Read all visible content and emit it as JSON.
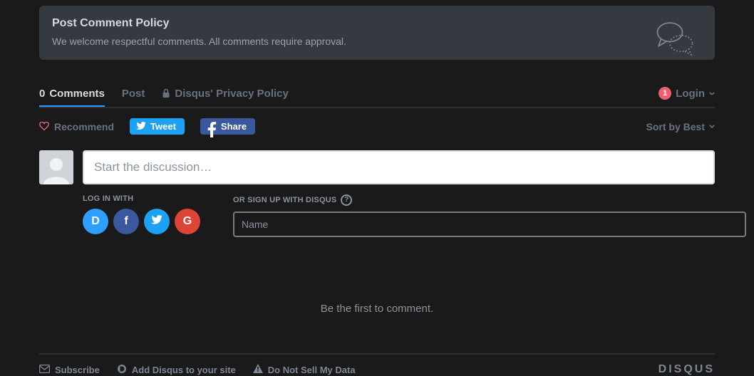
{
  "policy": {
    "title": "Post Comment Policy",
    "text": "We welcome respectful comments. All comments require approval."
  },
  "tabs": {
    "comments_count": "0",
    "comments_label": "Comments",
    "community_label": "Post",
    "privacy_label": "Disqus' Privacy Policy"
  },
  "login": {
    "badge": "1",
    "label": "Login"
  },
  "actions": {
    "recommend": "Recommend",
    "tweet": "Tweet",
    "share": "Share",
    "sort": "Sort by Best"
  },
  "compose": {
    "placeholder": "Start the discussion…"
  },
  "signup": {
    "login_with": "LOG IN WITH",
    "or_signup": "OR SIGN UP WITH DISQUS",
    "name_placeholder": "Name"
  },
  "empty": "Be the first to comment.",
  "footer": {
    "subscribe": "Subscribe",
    "add": "Add Disqus to your site",
    "dns": "Do Not Sell My Data",
    "logo": "DISQUS"
  },
  "colors": {
    "accent": "#2e9fff",
    "twitter": "#1da1f2",
    "facebook": "#3b579d",
    "google": "#db4437",
    "badge": "#f05f70"
  }
}
